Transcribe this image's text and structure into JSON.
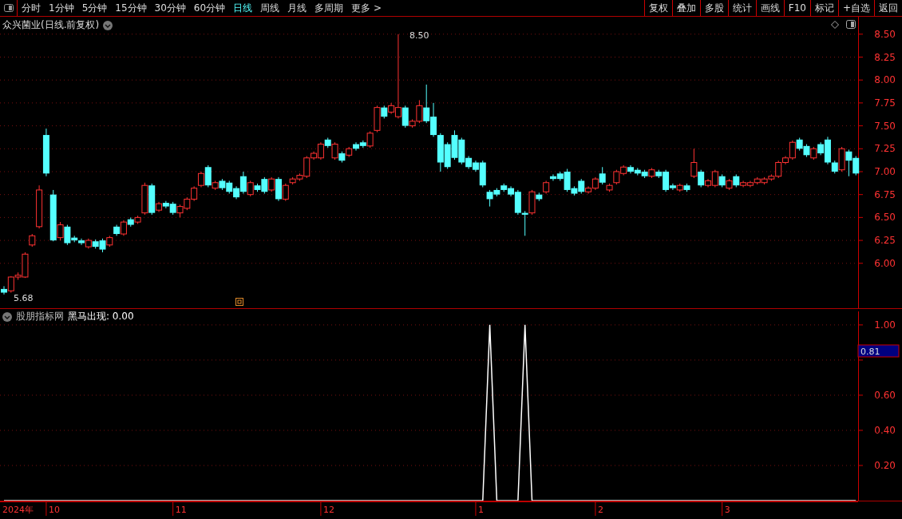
{
  "toolbar": {
    "tabs": [
      {
        "label": "分时",
        "selected": false
      },
      {
        "label": "1分钟",
        "selected": false
      },
      {
        "label": "5分钟",
        "selected": false
      },
      {
        "label": "15分钟",
        "selected": false
      },
      {
        "label": "30分钟",
        "selected": false
      },
      {
        "label": "60分钟",
        "selected": false
      },
      {
        "label": "日线",
        "selected": true
      },
      {
        "label": "周线",
        "selected": false
      },
      {
        "label": "月线",
        "selected": false
      },
      {
        "label": "多周期",
        "selected": false
      },
      {
        "label": "更多 >",
        "selected": false
      }
    ],
    "buttons": [
      "复权",
      "叠加",
      "多股",
      "统计",
      "画线",
      "F10",
      "标记",
      "+自选",
      "返回"
    ]
  },
  "price_panel": {
    "title": "众兴菌业(日线.前复权)",
    "chart_data": {
      "type": "candlestick",
      "ylim": [
        5.51,
        8.69
      ],
      "grid": true,
      "yticks": [
        {
          "value": 6,
          "label": "6.00"
        },
        {
          "value": 6.25,
          "label": "6.25"
        },
        {
          "value": 6.5,
          "label": "6.50"
        },
        {
          "value": 6.75,
          "label": "6.75"
        },
        {
          "value": 7,
          "label": "7.00"
        },
        {
          "value": 7.25,
          "label": "7.25"
        },
        {
          "value": 7.5,
          "label": "7.50"
        },
        {
          "value": 7.75,
          "label": "7.75"
        },
        {
          "value": 8,
          "label": "8.00"
        },
        {
          "value": 8.25,
          "label": "8.25"
        },
        {
          "value": 8.5,
          "label": "8.50"
        }
      ],
      "annotations": [
        {
          "text": "8.50"
        },
        {
          "text": "5.68"
        }
      ],
      "categories": [
        null,
        null,
        null,
        null,
        null,
        null,
        null,
        null,
        null,
        null,
        null,
        null,
        null,
        null,
        null,
        null,
        null,
        null,
        null,
        null,
        null,
        null,
        null,
        null,
        null,
        null,
        null,
        null,
        null,
        null,
        null,
        null,
        null,
        null,
        null,
        null,
        null,
        null,
        null,
        null,
        null,
        null,
        null,
        null,
        null,
        null,
        null,
        null,
        null,
        null,
        null,
        null,
        null,
        null,
        null,
        null,
        null,
        null,
        null,
        null,
        null,
        null,
        null,
        null,
        null,
        null,
        null,
        null,
        null,
        null,
        null,
        null,
        null,
        null,
        null,
        null,
        null,
        null,
        null,
        null,
        null,
        null,
        null,
        null,
        null,
        null,
        null,
        null,
        null,
        null,
        null,
        null,
        null,
        null,
        null,
        null,
        null,
        null,
        null,
        null,
        null,
        null,
        null,
        null,
        null,
        null,
        null,
        null,
        null,
        null,
        null,
        null,
        null,
        null,
        null,
        null,
        null,
        null,
        null,
        null,
        null,
        null
      ],
      "ohlc": [
        [
          5.72,
          5.75,
          5.66,
          5.68
        ],
        [
          5.7,
          5.86,
          5.68,
          5.85
        ],
        [
          5.85,
          5.9,
          5.82,
          5.87
        ],
        [
          5.85,
          6.12,
          5.84,
          6.1
        ],
        [
          6.2,
          6.32,
          6.18,
          6.3
        ],
        [
          6.4,
          6.85,
          6.38,
          6.8
        ],
        [
          7.4,
          7.47,
          6.95,
          6.98
        ],
        [
          6.75,
          6.8,
          6.24,
          6.25
        ],
        [
          6.28,
          6.45,
          6.25,
          6.42
        ],
        [
          6.4,
          6.42,
          6.2,
          6.22
        ],
        [
          6.28,
          6.3,
          6.23,
          6.25
        ],
        [
          6.25,
          6.27,
          6.2,
          6.22
        ],
        [
          6.18,
          6.27,
          6.16,
          6.25
        ],
        [
          6.24,
          6.26,
          6.16,
          6.18
        ],
        [
          6.25,
          6.27,
          6.12,
          6.15
        ],
        [
          6.2,
          6.3,
          6.18,
          6.28
        ],
        [
          6.4,
          6.42,
          6.3,
          6.32
        ],
        [
          6.32,
          6.47,
          6.3,
          6.45
        ],
        [
          6.48,
          6.5,
          6.4,
          6.42
        ],
        [
          6.45,
          6.52,
          6.43,
          6.5
        ],
        [
          6.55,
          6.88,
          6.53,
          6.85
        ],
        [
          6.85,
          6.87,
          6.53,
          6.55
        ],
        [
          6.58,
          6.67,
          6.56,
          6.65
        ],
        [
          6.66,
          6.68,
          6.6,
          6.62
        ],
        [
          6.65,
          6.67,
          6.53,
          6.55
        ],
        [
          6.55,
          6.64,
          6.5,
          6.62
        ],
        [
          6.6,
          6.72,
          6.58,
          6.7
        ],
        [
          6.7,
          6.84,
          6.68,
          6.82
        ],
        [
          6.85,
          7.0,
          6.83,
          6.98
        ],
        [
          7.05,
          7.07,
          6.83,
          6.85
        ],
        [
          6.82,
          6.9,
          6.8,
          6.88
        ],
        [
          6.9,
          6.92,
          6.8,
          6.82
        ],
        [
          6.88,
          6.9,
          6.76,
          6.78
        ],
        [
          6.82,
          6.84,
          6.7,
          6.72
        ],
        [
          6.95,
          7.0,
          6.76,
          6.78
        ],
        [
          6.75,
          6.9,
          6.73,
          6.88
        ],
        [
          6.85,
          6.87,
          6.78,
          6.8
        ],
        [
          6.92,
          6.94,
          6.76,
          6.78
        ],
        [
          6.8,
          6.94,
          6.78,
          6.92
        ],
        [
          6.92,
          6.94,
          6.68,
          6.7
        ],
        [
          6.7,
          6.87,
          6.68,
          6.85
        ],
        [
          6.88,
          6.94,
          6.86,
          6.92
        ],
        [
          6.92,
          6.98,
          6.9,
          6.96
        ],
        [
          6.95,
          7.17,
          6.93,
          7.15
        ],
        [
          7.15,
          7.22,
          7.13,
          7.2
        ],
        [
          7.15,
          7.32,
          7.13,
          7.3
        ],
        [
          7.35,
          7.37,
          7.26,
          7.28
        ],
        [
          7.15,
          7.32,
          7.13,
          7.3
        ],
        [
          7.2,
          7.22,
          7.1,
          7.12
        ],
        [
          7.18,
          7.27,
          7.16,
          7.25
        ],
        [
          7.3,
          7.32,
          7.23,
          7.25
        ],
        [
          7.32,
          7.34,
          7.26,
          7.28
        ],
        [
          7.28,
          7.44,
          7.26,
          7.42
        ],
        [
          7.45,
          7.72,
          7.43,
          7.7
        ],
        [
          7.7,
          7.72,
          7.58,
          7.6
        ],
        [
          7.65,
          7.75,
          7.63,
          7.72
        ],
        [
          7.6,
          8.5,
          7.58,
          7.7
        ],
        [
          7.7,
          7.72,
          7.48,
          7.5
        ],
        [
          7.5,
          7.57,
          7.48,
          7.55
        ],
        [
          7.55,
          7.78,
          7.53,
          7.72
        ],
        [
          7.7,
          7.95,
          7.53,
          7.55
        ],
        [
          7.6,
          7.75,
          7.38,
          7.4
        ],
        [
          7.4,
          7.42,
          7.0,
          7.1
        ],
        [
          7.3,
          7.32,
          7.03,
          7.05
        ],
        [
          7.4,
          7.45,
          7.13,
          7.15
        ],
        [
          7.35,
          7.37,
          7.08,
          7.1
        ],
        [
          7.15,
          7.17,
          7.03,
          7.05
        ],
        [
          7.1,
          7.12,
          7.0,
          7.02
        ],
        [
          7.1,
          7.12,
          6.83,
          6.85
        ],
        [
          6.78,
          6.8,
          6.62,
          6.7
        ],
        [
          6.8,
          6.82,
          6.73,
          6.75
        ],
        [
          6.85,
          6.87,
          6.78,
          6.8
        ],
        [
          6.82,
          6.84,
          6.73,
          6.75
        ],
        [
          6.78,
          6.8,
          6.53,
          6.55
        ],
        [
          6.55,
          6.57,
          6.3,
          6.53
        ],
        [
          6.55,
          6.8,
          6.53,
          6.78
        ],
        [
          6.75,
          6.77,
          6.68,
          6.7
        ],
        [
          6.78,
          6.9,
          6.76,
          6.88
        ],
        [
          6.95,
          6.97,
          6.9,
          6.92
        ],
        [
          6.98,
          7.0,
          6.9,
          6.92
        ],
        [
          7.0,
          7.03,
          6.78,
          6.8
        ],
        [
          6.82,
          6.84,
          6.74,
          6.76
        ],
        [
          6.9,
          6.92,
          6.76,
          6.78
        ],
        [
          6.78,
          6.84,
          6.76,
          6.82
        ],
        [
          6.82,
          6.94,
          6.8,
          6.92
        ],
        [
          6.98,
          7.05,
          6.86,
          6.88
        ],
        [
          6.8,
          6.87,
          6.78,
          6.85
        ],
        [
          6.88,
          7.02,
          6.86,
          7.0
        ],
        [
          6.98,
          7.07,
          6.96,
          7.05
        ],
        [
          7.05,
          7.07,
          6.98,
          7.0
        ],
        [
          7.02,
          7.04,
          6.96,
          6.98
        ],
        [
          7.0,
          7.02,
          6.93,
          6.95
        ],
        [
          6.95,
          7.04,
          6.93,
          7.02
        ],
        [
          7.0,
          7.02,
          6.93,
          6.95
        ],
        [
          7.0,
          7.02,
          6.78,
          6.8
        ],
        [
          6.85,
          6.87,
          6.8,
          6.82
        ],
        [
          6.8,
          6.87,
          6.78,
          6.85
        ],
        [
          6.85,
          6.87,
          6.78,
          6.8
        ],
        [
          6.95,
          7.25,
          6.93,
          7.1
        ],
        [
          7.0,
          7.02,
          6.83,
          6.85
        ],
        [
          6.85,
          6.92,
          6.83,
          6.9
        ],
        [
          6.85,
          7.02,
          6.83,
          7.0
        ],
        [
          6.95,
          6.97,
          6.83,
          6.85
        ],
        [
          6.82,
          6.92,
          6.8,
          6.9
        ],
        [
          6.95,
          6.97,
          6.83,
          6.85
        ],
        [
          6.85,
          6.9,
          6.83,
          6.88
        ],
        [
          6.85,
          6.9,
          6.83,
          6.88
        ],
        [
          6.88,
          6.94,
          6.86,
          6.92
        ],
        [
          6.88,
          6.94,
          6.86,
          6.92
        ],
        [
          6.92,
          6.97,
          6.9,
          6.95
        ],
        [
          6.95,
          7.12,
          6.93,
          7.1
        ],
        [
          7.1,
          7.17,
          7.08,
          7.15
        ],
        [
          7.15,
          7.34,
          7.13,
          7.32
        ],
        [
          7.35,
          7.37,
          7.23,
          7.25
        ],
        [
          7.28,
          7.3,
          7.16,
          7.18
        ],
        [
          7.15,
          7.27,
          7.13,
          7.25
        ],
        [
          7.3,
          7.32,
          7.18,
          7.2
        ],
        [
          7.35,
          7.38,
          7.08,
          7.1
        ],
        [
          7.1,
          7.12,
          6.98,
          7.0
        ],
        [
          7.02,
          7.27,
          7.0,
          7.25
        ],
        [
          7.22,
          7.24,
          6.95,
          7.12
        ],
        [
          7.15,
          7.17,
          6.96,
          6.98
        ]
      ]
    }
  },
  "date_axis": [
    "2024年",
    "10",
    "11",
    "12",
    "1",
    "2",
    "3"
  ],
  "indicator_panel": {
    "source": "股朋指标网",
    "label": "黑马出现: 0.00",
    "cursor_value": "0.81",
    "chart_data": {
      "type": "line",
      "ylim": [
        0,
        1.095
      ],
      "grid": true,
      "yticks": [
        {
          "value": 0.2,
          "label": "0.20"
        },
        {
          "value": 0.4,
          "label": "0.40"
        },
        {
          "value": 0.6,
          "label": "0.60"
        },
        {
          "value": 1,
          "label": "1.00"
        }
      ],
      "series": [
        {
          "color": "#ffffff",
          "values": [
            0,
            0,
            0,
            0,
            0,
            0,
            0,
            0,
            0,
            0,
            0,
            0,
            0,
            0,
            0,
            0,
            0,
            0,
            0,
            0,
            0,
            0,
            0,
            0,
            0,
            0,
            0,
            0,
            0,
            0,
            0,
            0,
            0,
            0,
            0,
            0,
            0,
            0,
            0,
            0,
            0,
            0,
            0,
            0,
            0,
            0,
            0,
            0,
            0,
            0,
            0,
            0,
            0,
            0,
            0,
            0,
            0,
            0,
            0,
            0,
            0,
            0,
            0,
            0,
            0,
            0,
            0,
            0,
            0,
            1,
            0,
            0,
            0,
            0,
            1,
            0,
            0,
            0,
            0,
            0,
            0,
            0,
            0,
            0,
            0,
            0,
            0,
            0,
            0,
            0,
            0,
            0,
            0,
            0,
            0,
            0,
            0,
            0,
            0,
            0,
            0,
            0,
            0,
            0,
            0,
            0,
            0,
            0,
            0,
            0,
            0,
            0,
            0,
            0,
            0,
            0,
            0,
            0,
            0,
            0,
            0,
            0
          ]
        }
      ]
    }
  }
}
